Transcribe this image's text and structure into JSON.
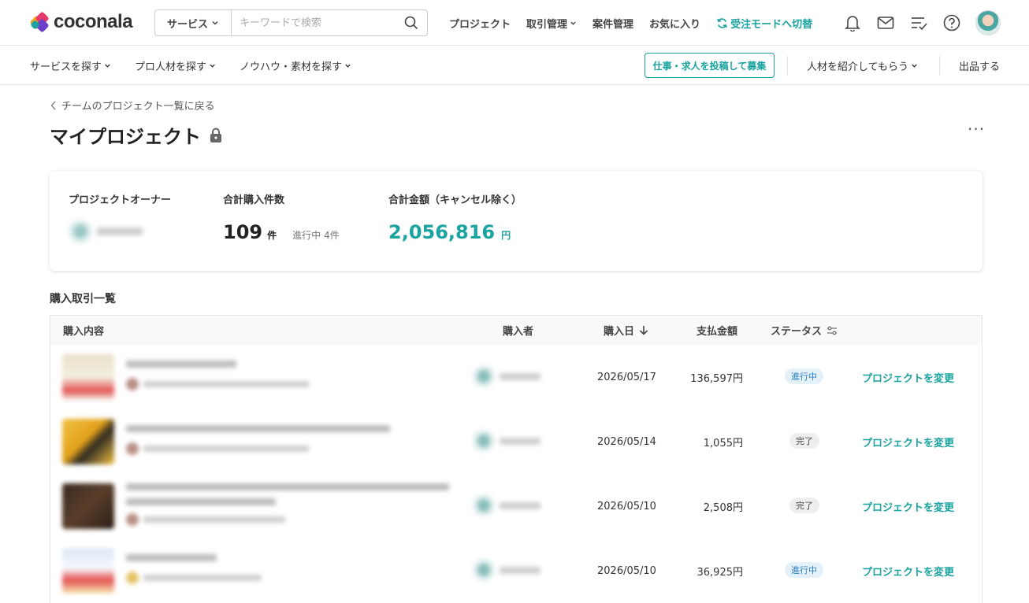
{
  "brand": {
    "name": "coconala"
  },
  "search": {
    "category": "サービス",
    "placeholder": "キーワードで検索"
  },
  "topnav": {
    "project": "プロジェクト",
    "transactions": "取引管理",
    "jobs": "案件管理",
    "favorites": "お気に入り",
    "mode_switch": "受注モードへ切替"
  },
  "subnav": {
    "find_service": "サービスを探す",
    "find_pro": "プロ人材を探す",
    "find_knowhow": "ノウハウ・素材を探す",
    "post_job": "仕事・求人を投稿して募集",
    "introduce": "人材を紹介してもらう",
    "sell": "出品する"
  },
  "page": {
    "back_link": "チームのプロジェクト一覧に戻る",
    "title": "マイプロジェクト",
    "more": "···"
  },
  "summary": {
    "owner_label": "プロジェクトオーナー",
    "count_label": "合計購入件数",
    "count_value": "109",
    "count_unit": "件",
    "count_sub": "進行中 4件",
    "amount_label": "合計金額（キャンセル除く）",
    "amount_value": "2,056,816",
    "amount_unit": "円"
  },
  "list": {
    "title": "購入取引一覧",
    "columns": {
      "content": "購入内容",
      "buyer": "購入者",
      "date": "購入日",
      "amount": "支払金額",
      "status": "ステータス"
    },
    "rows": [
      {
        "date": "2026/05/17",
        "amount": "136,597円",
        "status": "進行中",
        "action": "プロジェクトを変更"
      },
      {
        "date": "2026/05/14",
        "amount": "1,055円",
        "status": "完了",
        "action": "プロジェクトを変更"
      },
      {
        "date": "2026/05/10",
        "amount": "2,508円",
        "status": "完了",
        "action": "プロジェクトを変更"
      },
      {
        "date": "2026/05/10",
        "amount": "36,925円",
        "status": "進行中",
        "action": "プロジェクトを変更"
      }
    ]
  },
  "colors": {
    "accent": "#1aa39f",
    "progress_badge": "#e4f1fb",
    "done_badge": "#eeeeee"
  }
}
